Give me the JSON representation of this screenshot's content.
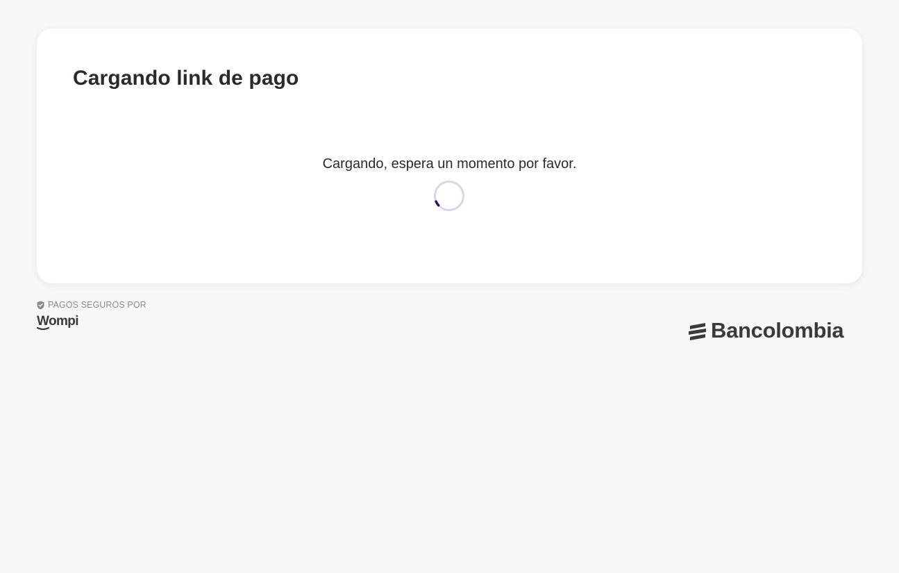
{
  "card": {
    "title": "Cargando link de pago",
    "loading_text": "Cargando, espera un momento por favor.",
    "spinner_color": "#2c0f5e",
    "spinner_track_color": "#ddd5e6"
  },
  "footer": {
    "secure_label": "PAGOS SEGUROS POR",
    "shield_icon": "shield-check-icon",
    "wompi_logo_text": "Wompi",
    "bancolombia_logo_text": "Bancolombia"
  },
  "colors": {
    "background": "#f8f8f8",
    "card": "#ffffff",
    "text": "#2c2a29",
    "muted": "#8a8a8a",
    "logo": "#3a3a3a"
  }
}
